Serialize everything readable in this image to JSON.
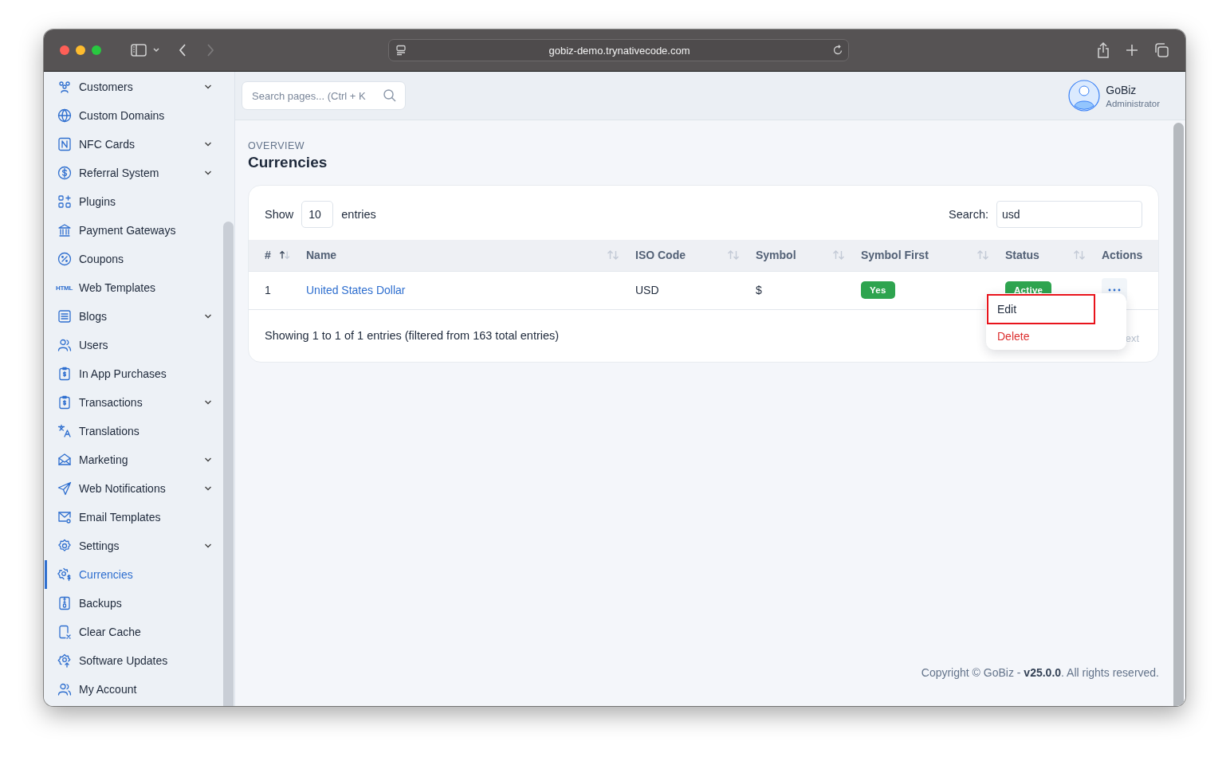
{
  "browser": {
    "url": "gobiz-demo.trynativecode.com"
  },
  "sidebar": {
    "items": [
      {
        "label": "Customers",
        "has_submenu": true,
        "selected": false
      },
      {
        "label": "Custom Domains",
        "has_submenu": false,
        "selected": false
      },
      {
        "label": "NFC Cards",
        "has_submenu": true,
        "selected": false
      },
      {
        "label": "Referral System",
        "has_submenu": true,
        "selected": false
      },
      {
        "label": "Plugins",
        "has_submenu": false,
        "selected": false
      },
      {
        "label": "Payment Gateways",
        "has_submenu": false,
        "selected": false
      },
      {
        "label": "Coupons",
        "has_submenu": false,
        "selected": false
      },
      {
        "label": "Web Templates",
        "icon_text": "HTML",
        "has_submenu": false,
        "selected": false
      },
      {
        "label": "Blogs",
        "has_submenu": true,
        "selected": false
      },
      {
        "label": "Users",
        "has_submenu": false,
        "selected": false
      },
      {
        "label": "In App Purchases",
        "has_submenu": false,
        "selected": false
      },
      {
        "label": "Transactions",
        "has_submenu": true,
        "selected": false
      },
      {
        "label": "Translations",
        "has_submenu": false,
        "selected": false
      },
      {
        "label": "Marketing",
        "has_submenu": true,
        "selected": false
      },
      {
        "label": "Web Notifications",
        "has_submenu": true,
        "selected": false
      },
      {
        "label": "Email Templates",
        "has_submenu": false,
        "selected": false
      },
      {
        "label": "Settings",
        "has_submenu": true,
        "selected": false
      },
      {
        "label": "Currencies",
        "has_submenu": false,
        "selected": true
      },
      {
        "label": "Backups",
        "has_submenu": false,
        "selected": false
      },
      {
        "label": "Clear Cache",
        "has_submenu": false,
        "selected": false
      },
      {
        "label": "Software Updates",
        "has_submenu": false,
        "selected": false
      },
      {
        "label": "My Account",
        "has_submenu": false,
        "selected": false
      }
    ]
  },
  "header": {
    "search": {
      "placeholder": "Search pages... (Ctrl + K"
    },
    "user": {
      "name": "GoBiz",
      "role": "Administrator"
    }
  },
  "page": {
    "eyebrow": "OVERVIEW",
    "title": "Currencies"
  },
  "table_controls": {
    "show_label": "Show",
    "page_size": "10",
    "entries_label": "entries",
    "search_label": "Search:",
    "search_value": "usd"
  },
  "table": {
    "columns": [
      {
        "label": "#",
        "sort_active": true
      },
      {
        "label": "Name",
        "sort_active": false
      },
      {
        "label": "ISO Code",
        "sort_active": false
      },
      {
        "label": "Symbol",
        "sort_active": false
      },
      {
        "label": "Symbol First",
        "sort_active": false
      },
      {
        "label": "Status",
        "sort_active": false
      },
      {
        "label": "Actions"
      }
    ],
    "rows": [
      {
        "number": "1",
        "name": "United States Dollar",
        "iso_code": "USD",
        "symbol": "$",
        "symbol_first": "Yes",
        "status": "Active"
      }
    ]
  },
  "info": "Showing 1 to 1 of 1 entries (filtered from 163 total entries)",
  "pagination_partial": "ext",
  "action_menu": {
    "items": [
      {
        "label": "Edit",
        "kind": "normal",
        "highlighted": true
      },
      {
        "label": "Delete",
        "kind": "danger",
        "highlighted": false
      }
    ]
  },
  "footer": {
    "copyright": "Copyright © GoBiz - **v25.0.0**. All rights reserved."
  }
}
